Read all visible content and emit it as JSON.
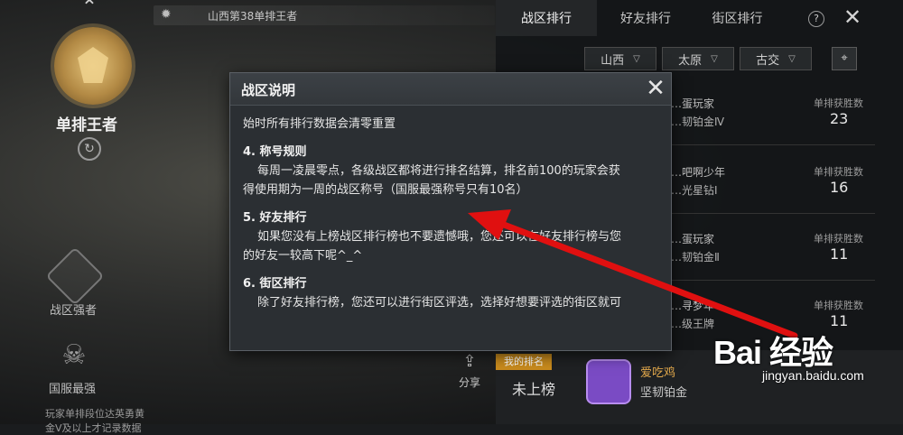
{
  "top_bar": {
    "label": "山西第38单排王者"
  },
  "left_rail": {
    "rank_title": "单排王者",
    "area_label": "战区强者",
    "national_label": "国服最强",
    "footnote": "玩家单排段位达英勇黄金Ⅴ及以上才记录数据"
  },
  "tabs": [
    {
      "label": "战区排行",
      "active": true
    },
    {
      "label": "好友排行",
      "active": false
    },
    {
      "label": "街区排行",
      "active": false
    }
  ],
  "filters": [
    {
      "label": "山西"
    },
    {
      "label": "太原"
    },
    {
      "label": "古交"
    }
  ],
  "rows": [
    {
      "name": "…蛋玩家",
      "tier": "…韧铂金Ⅳ",
      "win_label": "单排获胜数",
      "wins": "23"
    },
    {
      "name": "…吧啊少年",
      "tier": "…光星钻Ⅰ",
      "win_label": "单排获胜数",
      "wins": "16"
    },
    {
      "name": "…蛋玩家",
      "tier": "…韧铂金Ⅱ",
      "win_label": "单排获胜数",
      "wins": "11"
    },
    {
      "name": "…寻梦年",
      "tier": "…级王牌",
      "win_label": "单排获胜数",
      "wins": "11"
    }
  ],
  "my_rank": {
    "tag": "我的排名",
    "status": "未上榜",
    "share_label": "分享",
    "name": "爱吃鸡",
    "tier": "坚韧铂金"
  },
  "dialog": {
    "title": "战区说明",
    "intro": "始时所有排行数据会清零重置",
    "sections": [
      {
        "title": "4. 称号规则",
        "text": "每周一凌晨零点，各级战区都将进行排名结算，排名前100的玩家会获",
        "cont": "得使用期为一周的战区称号（国服最强称号只有10名）"
      },
      {
        "title": "5. 好友排行",
        "text": "如果您没有上榜战区排行榜也不要遗憾哦，您还可以在好友排行榜与您",
        "cont": "的好友一较高下呢^_^"
      },
      {
        "title": "6. 街区排行",
        "text": "除了好友排行榜，您还可以进行街区评选，选择好想要评选的街区就可",
        "cont": ""
      }
    ]
  },
  "watermark": {
    "logo": "Bai 经验",
    "url": "jingyan.baidu.com"
  },
  "colors": {
    "accent": "#c98b1d",
    "arrow": "#e01010",
    "panel": "#2b2f33"
  }
}
